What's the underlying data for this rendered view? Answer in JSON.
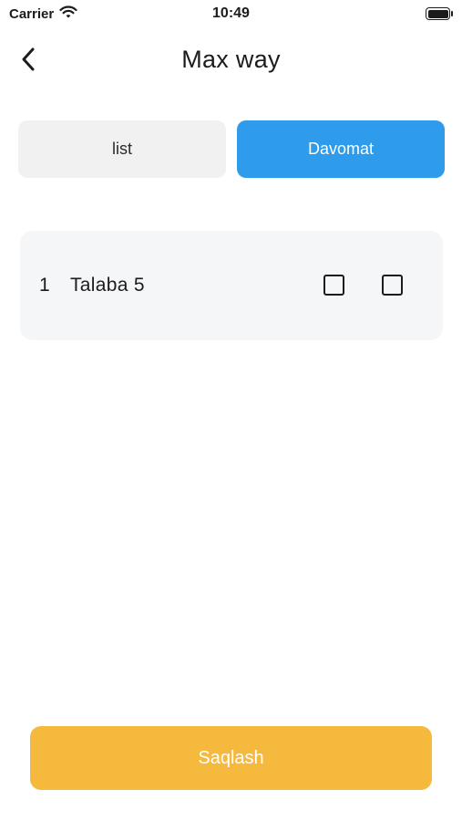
{
  "status_bar": {
    "carrier": "Carrier",
    "time": "10:49"
  },
  "nav": {
    "title": "Max way",
    "back_icon": "chevron-left-icon"
  },
  "tabs": [
    {
      "label": "list",
      "active": false
    },
    {
      "label": "Davomat",
      "active": true
    }
  ],
  "students": [
    {
      "number": "1",
      "name": "Talaba 5",
      "checkbox_1_checked": false,
      "checkbox_2_checked": false
    }
  ],
  "save_button": {
    "label": "Saqlash"
  },
  "colors": {
    "active_tab": "#2e9ceb",
    "inactive_tab": "#f1f1f2",
    "card_bg": "#f5f6f8",
    "save_button": "#f5b93d"
  }
}
